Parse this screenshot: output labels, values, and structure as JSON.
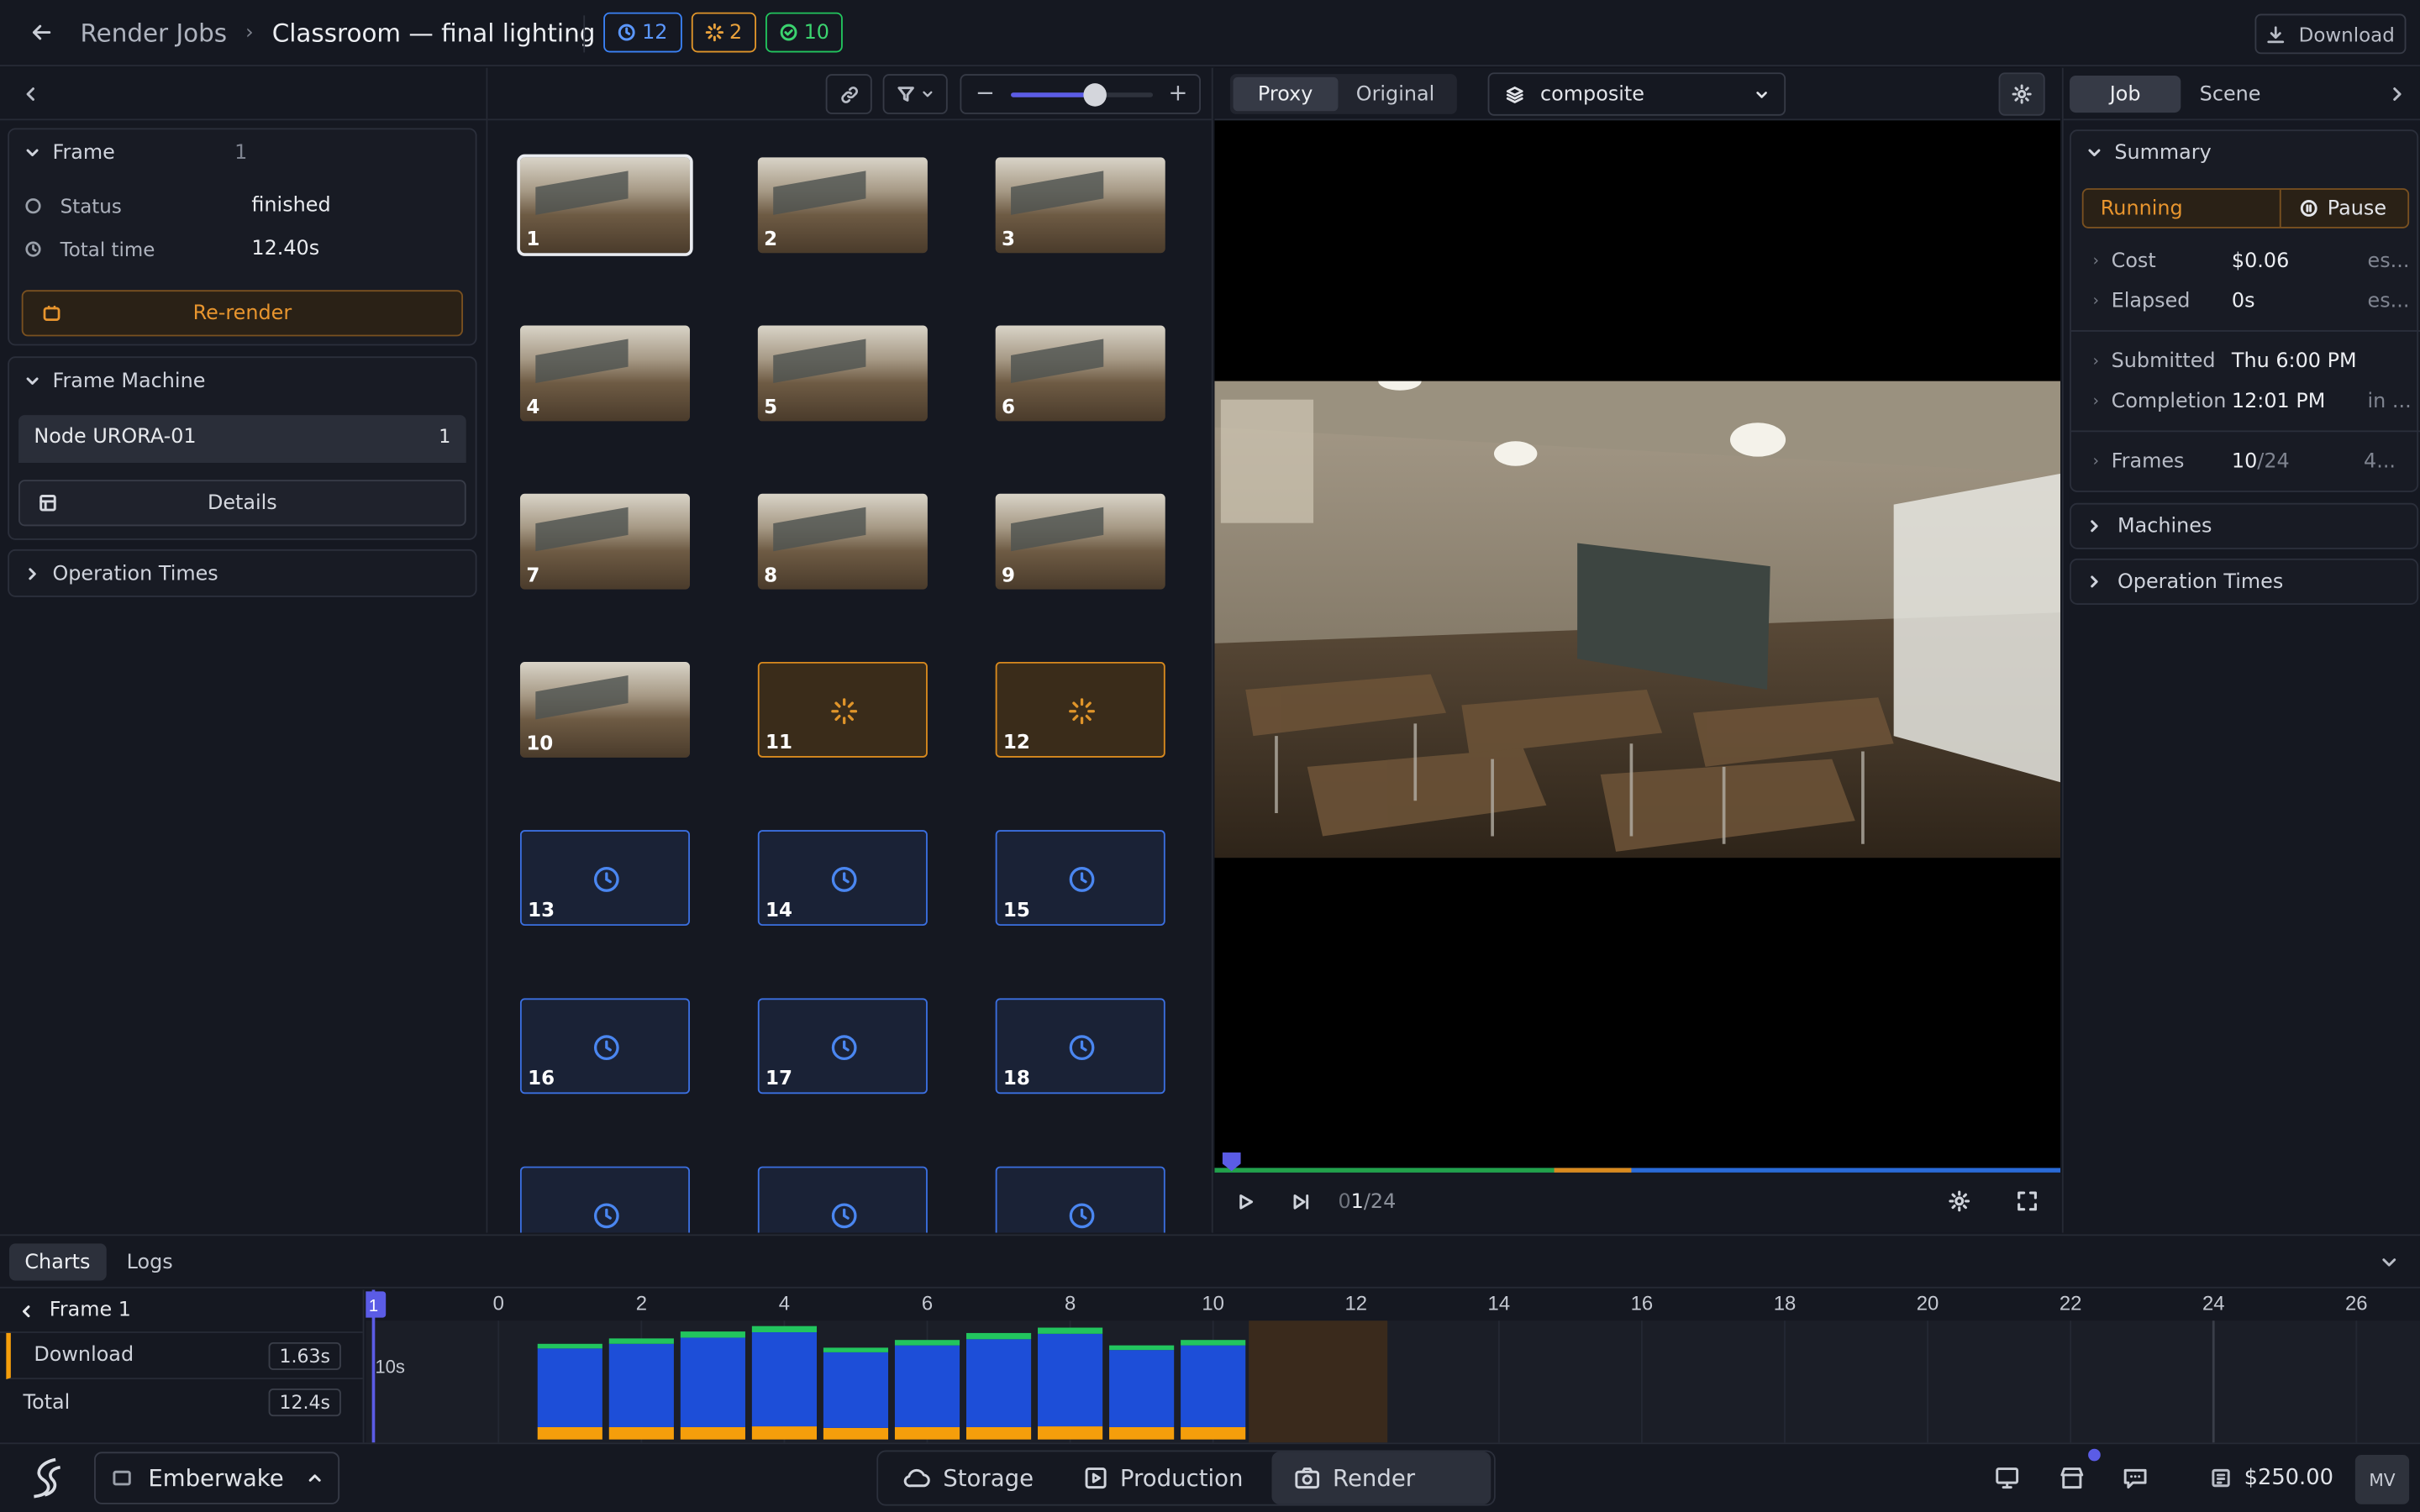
{
  "topbar": {
    "breadcrumb_root": "Render Jobs",
    "job_title": "Classroom — final lighting",
    "badge_queued": "12",
    "badge_running": "2",
    "badge_done": "10",
    "download_label": "Download",
    "colors": {
      "queued": "#3b82f6",
      "running": "#e0952a",
      "done": "#22c55e"
    }
  },
  "left": {
    "frame_title": "Frame",
    "frame_number": "1",
    "status_label": "Status",
    "status_value": "finished",
    "total_time_label": "Total time",
    "total_time_value": "12.40s",
    "rerender_label": "Re-render",
    "machine_title": "Frame Machine",
    "node_name": "Node URORA-01",
    "node_count": "1",
    "details_label": "Details",
    "operation_times_label": "Operation Times"
  },
  "grid": {
    "frames": [
      {
        "n": "1",
        "state": "done",
        "selected": true
      },
      {
        "n": "2",
        "state": "done"
      },
      {
        "n": "3",
        "state": "done"
      },
      {
        "n": "4",
        "state": "done"
      },
      {
        "n": "5",
        "state": "done"
      },
      {
        "n": "6",
        "state": "done"
      },
      {
        "n": "7",
        "state": "done"
      },
      {
        "n": "8",
        "state": "done"
      },
      {
        "n": "9",
        "state": "done"
      },
      {
        "n": "10",
        "state": "done"
      },
      {
        "n": "11",
        "state": "running"
      },
      {
        "n": "12",
        "state": "running"
      },
      {
        "n": "13",
        "state": "queued"
      },
      {
        "n": "14",
        "state": "queued"
      },
      {
        "n": "15",
        "state": "queued"
      },
      {
        "n": "16",
        "state": "queued"
      },
      {
        "n": "17",
        "state": "queued"
      },
      {
        "n": "18",
        "state": "queued"
      },
      {
        "n": "",
        "state": "queued"
      },
      {
        "n": "",
        "state": "queued"
      },
      {
        "n": "",
        "state": "queued"
      }
    ]
  },
  "viewer": {
    "tab_proxy": "Proxy",
    "tab_original": "Original",
    "layer_select": "composite",
    "frame_counter_prefix": "0",
    "frame_counter_current": "1",
    "frame_counter_total": "/24"
  },
  "right": {
    "tab_job": "Job",
    "tab_scene": "Scene",
    "summary_title": "Summary",
    "status_running": "Running",
    "pause_label": "Pause",
    "cost_label": "Cost",
    "cost_value": "$0.06",
    "cost_est": "es...",
    "elapsed_label": "Elapsed",
    "elapsed_value": "0s",
    "elapsed_est": "es...",
    "submitted_label": "Submitted",
    "submitted_value": "Thu 6:00 PM",
    "completion_label": "Completion",
    "completion_value": "12:01 PM",
    "completion_est": "in ...",
    "frames_label": "Frames",
    "frames_done": "10",
    "frames_total": "/24",
    "frames_est": "4...",
    "machines_label": "Machines",
    "operation_times_label": "Operation Times"
  },
  "bottom": {
    "tab_charts": "Charts",
    "tab_logs": "Logs",
    "frame_label": "Frame 1",
    "download_label": "Download",
    "download_value": "1.63s",
    "total_label": "Total",
    "total_value": "12.4s",
    "playhead_label": "1",
    "y_label": "10s"
  },
  "chart_data": {
    "type": "bar",
    "x_ticks": [
      "0",
      "2",
      "4",
      "6",
      "8",
      "10",
      "12",
      "14",
      "16",
      "18",
      "20",
      "22",
      "24",
      "26"
    ],
    "categories": [
      "1",
      "2",
      "3",
      "4",
      "5",
      "6",
      "7",
      "8",
      "9",
      "10"
    ],
    "series": [
      {
        "color": "#f59e0b",
        "values": [
          1.6,
          1.6,
          1.6,
          1.7,
          1.5,
          1.6,
          1.6,
          1.7,
          1.6,
          1.6
        ]
      },
      {
        "color": "#1d4ed8",
        "values": [
          10.2,
          10.8,
          11.6,
          12.2,
          9.8,
          10.6,
          11.4,
          12.0,
          10.0,
          10.6
        ]
      },
      {
        "color": "#22c55e",
        "values": [
          0.6,
          0.7,
          0.8,
          0.8,
          0.6,
          0.7,
          0.8,
          0.8,
          0.6,
          0.7
        ]
      }
    ],
    "running_range": [
      11,
      12
    ]
  },
  "dock": {
    "project_name": "Emberwake",
    "storage_label": "Storage",
    "production_label": "Production",
    "render_label": "Render",
    "balance": "$250.00",
    "avatar_initials": "MV"
  }
}
